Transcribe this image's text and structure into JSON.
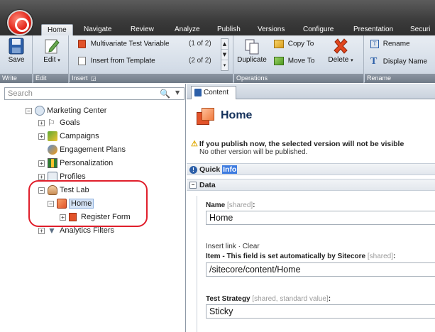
{
  "ribbon": {
    "tabs": [
      "Home",
      "Navigate",
      "Review",
      "Analyze",
      "Publish",
      "Versions",
      "Configure",
      "Presentation",
      "Securi"
    ],
    "active_tab": "Home",
    "groups": {
      "write": {
        "label": "Write",
        "save": "Save"
      },
      "edit": {
        "label": "Edit",
        "edit": "Edit"
      },
      "insert": {
        "label": "Insert",
        "items": [
          {
            "label": "Multivariate Test Variable",
            "count": "(1 of 2)"
          },
          {
            "label": "Insert from Template",
            "count": "(2 of 2)"
          }
        ]
      },
      "operations": {
        "label": "Operations",
        "duplicate": "Duplicate",
        "copy_to": "Copy To",
        "move_to": "Move To",
        "delete": "Delete"
      },
      "rename": {
        "label": "Rename",
        "rename": "Rename",
        "display_name": "Display Name"
      }
    }
  },
  "search": {
    "placeholder": "Search"
  },
  "tree": {
    "marketing_center": "Marketing Center",
    "goals": "Goals",
    "campaigns": "Campaigns",
    "engagement_plans": "Engagement Plans",
    "personalization": "Personalization",
    "profiles": "Profiles",
    "test_lab": "Test Lab",
    "home": "Home",
    "register_form": "Register Form",
    "analytics_filters": "Analytics Filters"
  },
  "content": {
    "tab": "Content",
    "title": "Home",
    "warning": "If you publish now, the selected version will not be visible",
    "warning_sub": "No other version will be published.",
    "quick_info_a": "Quick ",
    "quick_info_b": "Info",
    "data_section": "Data",
    "fields": {
      "name_label": "Name",
      "name_hint": " [shared]",
      "name_value": "Home",
      "insert_link": "Insert link",
      "clear": "Clear",
      "item_label": "Item - This field is set automatically by Sitecore",
      "item_hint": " [shared]",
      "item_value": "/sitecore/content/Home",
      "strategy_label": "Test Strategy",
      "strategy_hint": " [shared, standard value]",
      "strategy_value": "Sticky"
    }
  }
}
